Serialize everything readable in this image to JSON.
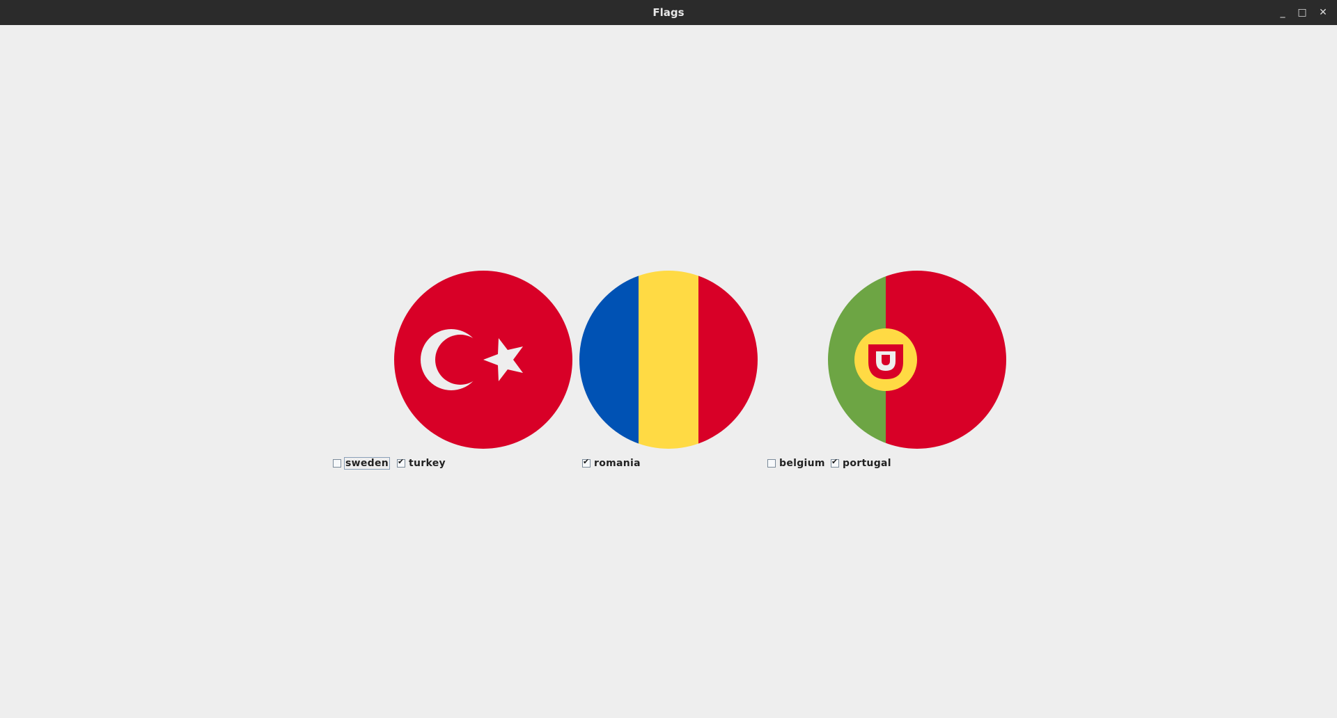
{
  "window": {
    "title": "Flags",
    "controls": {
      "minimize_icon": "minimize-icon",
      "maximize_icon": "maximize-icon",
      "close_icon": "close-icon",
      "minimize_glyph": "_",
      "maximize_glyph": "□",
      "close_glyph": "✕"
    }
  },
  "colors": {
    "background": "#eeeeee",
    "titlebar": "#2b2b2b",
    "red": "#d80027",
    "blue": "#0052b4",
    "yellow": "#ffda44",
    "green": "#6da544",
    "white": "#eeeeee"
  },
  "flags": [
    {
      "name": "turkey",
      "icon": "turkey-flag-icon"
    },
    {
      "name": "romania",
      "icon": "romania-flag-icon"
    },
    {
      "name": "portugal",
      "icon": "portugal-flag-icon"
    }
  ],
  "checkboxes": [
    {
      "label": "sweden",
      "checked": false,
      "focused": true
    },
    {
      "label": "turkey",
      "checked": true
    },
    {
      "label": "romania",
      "checked": true
    },
    {
      "label": "belgium",
      "checked": false
    },
    {
      "label": "portugal",
      "checked": true
    }
  ]
}
